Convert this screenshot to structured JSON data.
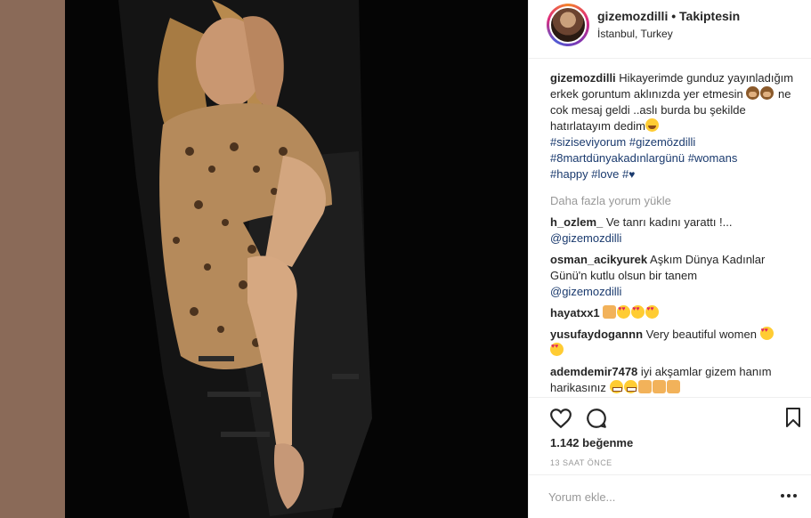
{
  "post": {
    "username": "gizemozdilli",
    "dot": "•",
    "follow_label": "Takiptesin",
    "location": "İstanbul, Turkey"
  },
  "caption": {
    "username": "gizemozdilli",
    "text1": "Hikayerimde gunduz yayınladığım erkek goruntum aklınızda yer etmesin",
    "text2": "ne cok mesaj geldi ..aslı burda bu şekilde hatırlatayım dedim",
    "hashtags": [
      "#siziseviyorum",
      "#gizemözdilli",
      "#8martdünyakadınlargünü",
      "#womans",
      "#happy",
      "#love",
      "#"
    ]
  },
  "load_more": "Daha fazla yorum yükle",
  "comments": [
    {
      "username": "h_ozlem_",
      "text": "Ve tanrı kadını yarattı !...",
      "mention": "@gizemozdilli"
    },
    {
      "username": "osman_acikyurek",
      "text": "Aşkım Dünya Kadınlar Günü'n kutlu olsun bir tanem",
      "mention": "@gizemozdilli"
    },
    {
      "username": "hayatxx1",
      "text": ""
    },
    {
      "username": "yusufaydogannn",
      "text": "Very beautiful women"
    },
    {
      "username": "ademdemir7478",
      "text": "iyi akşamlar gizem hanım harikasınız"
    }
  ],
  "likes_text": "1.142 beğenme",
  "time_text": "13 SAAT ÖNCE",
  "add_comment": {
    "placeholder": "Yorum ekle..."
  },
  "icons": {
    "like": "heart-icon",
    "comment": "comment-bubble-icon",
    "save": "bookmark-icon",
    "options": "more-options-icon"
  },
  "colors": {
    "backdrop": "#8a6a58",
    "link": "#1a3a6e",
    "muted": "#999999",
    "text": "#262626"
  }
}
